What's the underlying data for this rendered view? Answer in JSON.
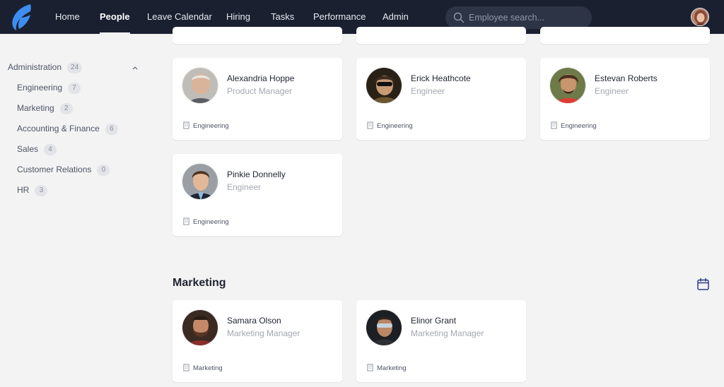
{
  "nav": {
    "items": [
      {
        "label": "Home",
        "active": false
      },
      {
        "label": "People",
        "active": true
      },
      {
        "label": "Leave Calendar",
        "active": false
      },
      {
        "label": "Hiring",
        "active": false
      },
      {
        "label": "Tasks",
        "active": false
      },
      {
        "label": "Performance",
        "active": false
      },
      {
        "label": "Admin",
        "active": false
      }
    ],
    "search_placeholder": "Employee search..."
  },
  "sidebar": {
    "groups": [
      {
        "label": "Administration",
        "count": "24",
        "expanded": true
      },
      {
        "label": "Engineering",
        "count": "7"
      },
      {
        "label": "Marketing",
        "count": "2"
      },
      {
        "label": "Accounting & Finance",
        "count": "6"
      },
      {
        "label": "Sales",
        "count": "4"
      },
      {
        "label": "Customer Relations",
        "count": "0"
      },
      {
        "label": "HR",
        "count": "3"
      }
    ]
  },
  "engineering": {
    "people": [
      {
        "name": "Alexandria Hoppe",
        "role": "Product Manager",
        "department": "Engineering"
      },
      {
        "name": "Erick Heathcote",
        "role": "Engineer",
        "department": "Engineering"
      },
      {
        "name": "Estevan Roberts",
        "role": "Engineer",
        "department": "Engineering"
      },
      {
        "name": "Pinkie Donnelly",
        "role": "Engineer",
        "department": "Engineering"
      }
    ]
  },
  "marketing": {
    "title": "Marketing",
    "people": [
      {
        "name": "Samara Olson",
        "role": "Marketing Manager",
        "department": "Marketing"
      },
      {
        "name": "Elinor Grant",
        "role": "Marketing Manager",
        "department": "Marketing"
      }
    ]
  },
  "icons": {
    "logo": "feather-logo-icon",
    "search": "search-icon",
    "collapse": "chevron-up-icon",
    "department": "building-icon",
    "calendar": "calendar-icon"
  },
  "colors": {
    "nav_bg": "#1b2031",
    "logo_blue": "#3d8ef0",
    "accent": "#2b3a8c",
    "page_bg": "#f3f3f4"
  }
}
